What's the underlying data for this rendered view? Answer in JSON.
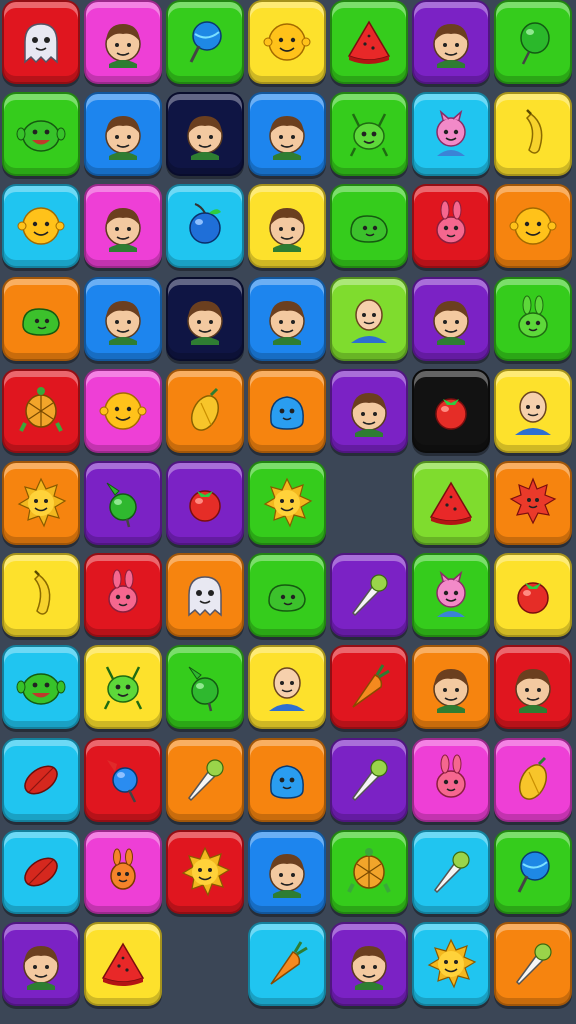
{
  "palette": {
    "red": "#e0161f",
    "pink": "#ee3fd6",
    "green": "#35cc1c",
    "lime": "#7fdc2e",
    "yellow": "#fde12c",
    "purple": "#7b22c5",
    "blue": "#1d85ee",
    "cyan": "#20c5f0",
    "orange": "#f6840f",
    "navy": "#0f1544",
    "black": "#121212"
  },
  "grid": {
    "rows": 11,
    "cols": 7,
    "tiles": [
      [
        [
          "red",
          "ghost-icon"
        ],
        [
          "pink",
          "boy-icon"
        ],
        [
          "green",
          "lollipop-icon"
        ],
        [
          "yellow",
          "smiley-face-icon"
        ],
        [
          "green",
          "cone-slice-icon"
        ],
        [
          "purple",
          "boy-icon"
        ],
        [
          "green",
          "green-balloon-icon"
        ]
      ],
      [
        [
          "green",
          "goblin-face-icon"
        ],
        [
          "blue",
          "boy-icon"
        ],
        [
          "navy",
          "boy-icon"
        ],
        [
          "blue",
          "boy-icon"
        ],
        [
          "green",
          "green-alien-icon"
        ],
        [
          "cyan",
          "pink-creature-icon"
        ],
        [
          "yellow",
          "banana-icon"
        ]
      ],
      [
        [
          "cyan",
          "smiley-face-icon"
        ],
        [
          "pink",
          "boy-icon"
        ],
        [
          "cyan",
          "blue-fruit-icon"
        ],
        [
          "yellow",
          "boy-icon"
        ],
        [
          "green",
          "green-blob-icon"
        ],
        [
          "red",
          "pink-bunny-icon"
        ],
        [
          "orange",
          "smiley-face-icon"
        ]
      ],
      [
        [
          "orange",
          "green-blob-icon"
        ],
        [
          "blue",
          "boy-icon"
        ],
        [
          "navy",
          "boy-icon"
        ],
        [
          "blue",
          "boy-icon"
        ],
        [
          "lime",
          "bald-man-icon"
        ],
        [
          "purple",
          "boy-icon"
        ],
        [
          "green",
          "green-bunny-icon"
        ]
      ],
      [
        [
          "red",
          "turtle-icon"
        ],
        [
          "pink",
          "smiley-face-icon"
        ],
        [
          "orange",
          "mango-icon"
        ],
        [
          "orange",
          "blue-blob-icon"
        ],
        [
          "purple",
          "boy-icon"
        ],
        [
          "black",
          "tomato-icon"
        ],
        [
          "yellow",
          "bald-man-icon"
        ]
      ],
      [
        [
          "orange",
          "sun-face-icon"
        ],
        [
          "purple",
          "green-candy-icon"
        ],
        [
          "purple",
          "tomato-icon"
        ],
        [
          "green",
          "sun-face-icon"
        ],
        null,
        [
          "lime",
          "cone-slice-icon"
        ],
        [
          "orange",
          "red-spiky-icon"
        ]
      ],
      [
        [
          "yellow",
          "banana-icon"
        ],
        [
          "red",
          "pink-bunny-icon"
        ],
        [
          "orange",
          "ghost-icon"
        ],
        [
          "green",
          "green-blob-icon"
        ],
        [
          "purple",
          "icecream-cone-icon"
        ],
        [
          "green",
          "pink-creature-icon"
        ],
        [
          "yellow",
          "tomato-icon"
        ]
      ],
      [
        [
          "cyan",
          "goblin-face-icon"
        ],
        [
          "yellow",
          "green-alien-icon"
        ],
        [
          "green",
          "green-candy-icon"
        ],
        [
          "yellow",
          "bald-man-icon"
        ],
        [
          "red",
          "carrot-icon"
        ],
        [
          "orange",
          "boy-icon"
        ],
        [
          "red",
          "boy-icon"
        ]
      ],
      [
        [
          "cyan",
          "red-seed-icon"
        ],
        [
          "red",
          "blue-candy-icon"
        ],
        [
          "orange",
          "icecream-cone-icon"
        ],
        [
          "orange",
          "blue-blob-icon"
        ],
        [
          "purple",
          "icecream-cone-icon"
        ],
        [
          "pink",
          "pink-bunny-icon"
        ],
        [
          "pink",
          "mango-icon"
        ]
      ],
      [
        [
          "cyan",
          "red-seed-icon"
        ],
        [
          "pink",
          "orange-bunny-icon"
        ],
        [
          "red",
          "sun-face-icon"
        ],
        [
          "blue",
          "boy-icon"
        ],
        [
          "green",
          "turtle-icon"
        ],
        [
          "cyan",
          "icecream-cone-icon"
        ],
        [
          "green",
          "lollipop-icon"
        ]
      ],
      [
        [
          "purple",
          "boy-icon"
        ],
        [
          "yellow",
          "cone-slice-icon"
        ],
        null,
        [
          "cyan",
          "carrot-icon"
        ],
        [
          "purple",
          "boy-icon"
        ],
        [
          "cyan",
          "sun-face-icon"
        ],
        [
          "orange",
          "icecream-cone-icon"
        ]
      ]
    ]
  }
}
